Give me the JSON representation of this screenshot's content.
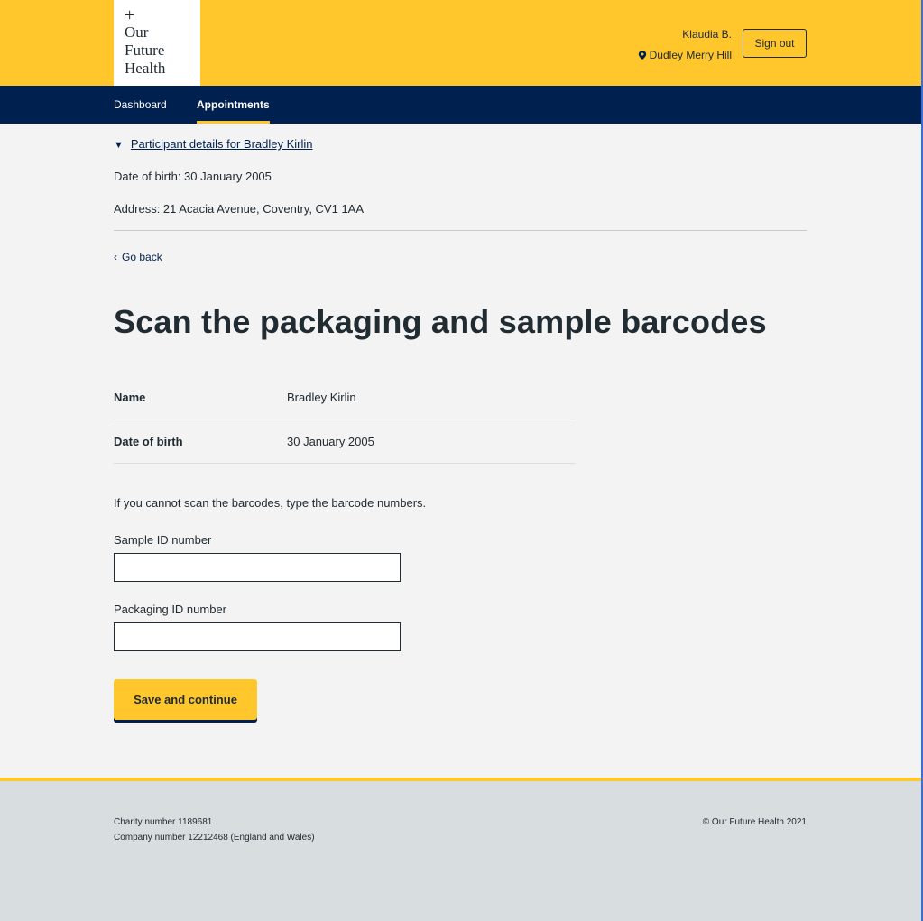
{
  "header": {
    "logo": {
      "plus": "+",
      "lines": [
        "Our",
        "Future",
        "Health"
      ]
    },
    "user_name": "Klaudia B.",
    "location": "Dudley Merry Hill",
    "sign_out_label": "Sign out"
  },
  "nav": {
    "items": [
      {
        "label": "Dashboard",
        "active": false
      },
      {
        "label": "Appointments",
        "active": true
      }
    ]
  },
  "participant": {
    "summary_link": "Participant details for Bradley Kirlin",
    "dob_line": "Date of birth: 30 January 2005",
    "address_line": "Address: 21 Acacia Avenue, Coventry, CV1 1AA"
  },
  "go_back_label": "Go back",
  "page_title": "Scan the packaging and sample barcodes",
  "summary_list": [
    {
      "key": "Name",
      "value": "Bradley Kirlin"
    },
    {
      "key": "Date of birth",
      "value": "30 January 2005"
    }
  ],
  "hint": "If you cannot scan the barcodes, type the barcode numbers.",
  "fields": {
    "sample_id": {
      "label": "Sample ID number",
      "value": ""
    },
    "packaging_id": {
      "label": "Packaging ID number",
      "value": ""
    }
  },
  "primary_button_label": "Save and continue",
  "footer": {
    "charity": "Charity number 1189681",
    "company": "Company number 12212468 (England and Wales)",
    "copyright": "© Our Future Health 2021"
  },
  "colors": {
    "brand_yellow": "#ffc72c",
    "nav_navy": "#002050",
    "text": "#212b32",
    "page_bg": "#f3f3f3",
    "footer_bg": "#d8dde0"
  }
}
